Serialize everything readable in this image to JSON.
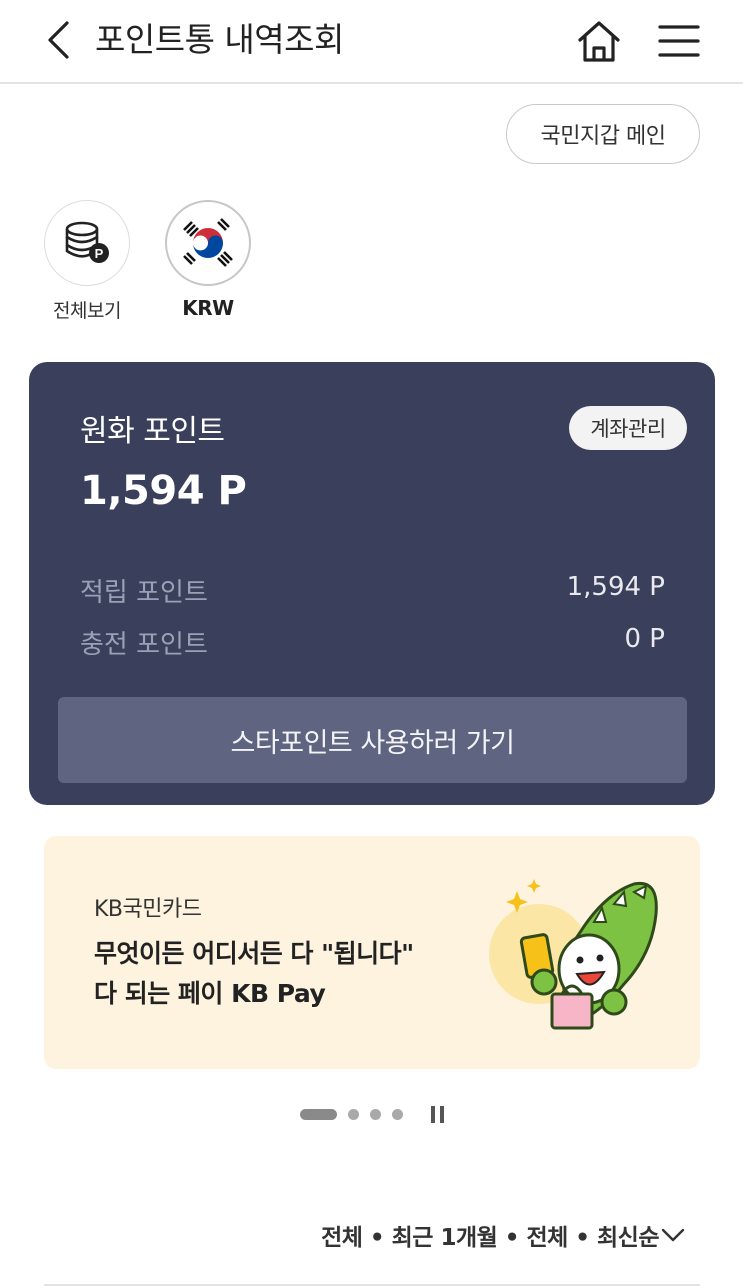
{
  "header": {
    "title": "포인트통 내역조회",
    "icons": {
      "back": "chevron-left-icon",
      "home": "home-icon",
      "menu": "hamburger-menu-icon"
    }
  },
  "wallet_main_button": "국민지갑 메인",
  "currency_chips": [
    {
      "label": "전체보기",
      "icon": "coin-stack-icon",
      "active": false
    },
    {
      "label": "KRW",
      "icon": "korea-flag-icon",
      "active": true
    }
  ],
  "point_card": {
    "title": "원화 포인트",
    "account_button": "계좌관리",
    "total": "1,594 P",
    "rows": [
      {
        "label": "적립 포인트",
        "value": "1,594 P"
      },
      {
        "label": "충전 포인트",
        "value": "0 P"
      }
    ],
    "action_button": "스타포인트 사용하러 가기",
    "colors": {
      "background": "#3a3f5b",
      "button": "#5f6480"
    }
  },
  "banner": {
    "brand": "KB국민카드",
    "line1": "무엇이든 어디서든 다 \"됩니다\"",
    "line2": "다 되는 페이 KB Pay",
    "background": "#fdf3df",
    "pager": {
      "total": 4,
      "current": 1
    }
  },
  "filter": {
    "text": "전체 • 최근 1개월 • 전체 • 최신순",
    "icon": "chevron-down-icon"
  }
}
